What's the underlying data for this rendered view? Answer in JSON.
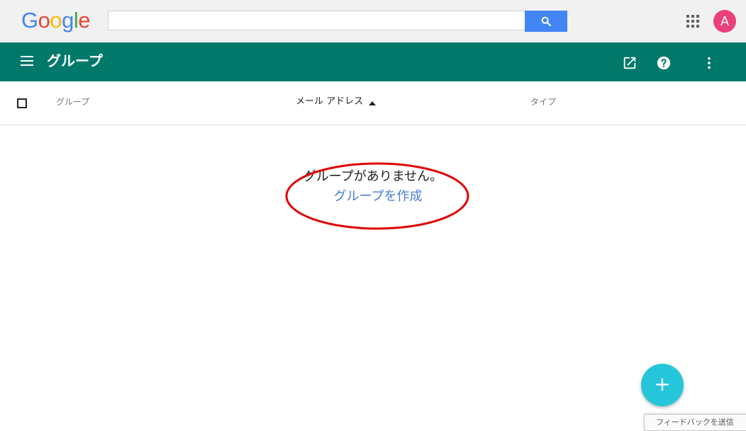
{
  "google_bar": {
    "logo_letters": [
      {
        "char": "G",
        "color": "#4285f4"
      },
      {
        "char": "o",
        "color": "#ea4335"
      },
      {
        "char": "o",
        "color": "#fbbc05"
      },
      {
        "char": "g",
        "color": "#4285f4"
      },
      {
        "char": "l",
        "color": "#34a853"
      },
      {
        "char": "e",
        "color": "#ea4335"
      }
    ],
    "search": {
      "value": "",
      "placeholder": ""
    },
    "avatar_initial": "A",
    "avatar_color": "#ec407a"
  },
  "app_bar": {
    "title": "グループ",
    "bg_color": "#00796b",
    "icons": [
      "menu-icon",
      "open-in-new-icon",
      "help-icon",
      "more-vert-icon"
    ]
  },
  "table": {
    "columns": [
      {
        "label": "グループ",
        "sorted": false
      },
      {
        "label": "メール アドレス",
        "sorted": true,
        "direction": "ascending"
      },
      {
        "label": "タイプ",
        "sorted": false
      }
    ]
  },
  "empty_state": {
    "message": "グループがありません。",
    "create_link": "グループを作成",
    "link_color": "#4a7fd8"
  },
  "fab": {
    "label": "+",
    "color": "#26c6da"
  },
  "feedback": {
    "label": "フィードバックを送信"
  }
}
